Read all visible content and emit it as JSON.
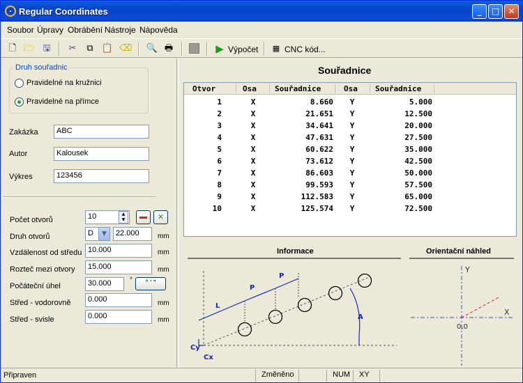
{
  "window": {
    "title": "Regular Coordinates"
  },
  "menu": [
    "Soubor",
    "Úpravy",
    "Obrábění",
    "Nástroje",
    "Nápověda"
  ],
  "toolbar": {
    "compute_label": "Výpočet",
    "cnc_label": "CNC kód...",
    "compute_color": "#13a10e"
  },
  "left": {
    "group_title": "Druh souřadnic",
    "radio_circle": "Pravidelné na kružnici",
    "radio_line": "Pravidelné na přímce",
    "selected": "line",
    "fields": [
      {
        "label": "Zakázka",
        "value": "ABC"
      },
      {
        "label": "Autor",
        "value": "Kalousek"
      },
      {
        "label": "Výkres",
        "value": "123456"
      }
    ],
    "params": {
      "count_label": "Počet otvorů",
      "count_value": "10",
      "type_label": "Druh otvorů",
      "type_value": "D",
      "type_size": "22.000",
      "dist_label": "Vzdálenost od středu",
      "dist_value": "10.000",
      "pitch_label": "Rozteč mezi otvory",
      "pitch_value": "15.000",
      "angle_label": "Počáteční úhel",
      "angle_value": "30.000",
      "angle_unit": "°",
      "dms_label": "° ' \"",
      "cx_label": "Střed - vodorovně",
      "cx_value": "0.000",
      "cy_label": "Střed - svisle",
      "cy_value": "0.000",
      "mm": "mm"
    }
  },
  "coords": {
    "title": "Souřadnice",
    "headers": [
      "Otvor",
      "Osa",
      "Souřadnice",
      "Osa",
      "Souřadnice"
    ],
    "rows": [
      [
        "1",
        "X",
        "8.660",
        "Y",
        "5.000"
      ],
      [
        "2",
        "X",
        "21.651",
        "Y",
        "12.500"
      ],
      [
        "3",
        "X",
        "34.641",
        "Y",
        "20.000"
      ],
      [
        "4",
        "X",
        "47.631",
        "Y",
        "27.500"
      ],
      [
        "5",
        "X",
        "60.622",
        "Y",
        "35.000"
      ],
      [
        "6",
        "X",
        "73.612",
        "Y",
        "42.500"
      ],
      [
        "7",
        "X",
        "86.603",
        "Y",
        "50.000"
      ],
      [
        "8",
        "X",
        "99.593",
        "Y",
        "57.500"
      ],
      [
        "9",
        "X",
        "112.583",
        "Y",
        "65.000"
      ],
      [
        "10",
        "X",
        "125.574",
        "Y",
        "72.500"
      ]
    ]
  },
  "info": {
    "title": "Informace",
    "labels": {
      "L": "L",
      "P1": "P",
      "P2": "P",
      "A": "A",
      "Cy": "Cy",
      "Cx": "Cx"
    }
  },
  "preview": {
    "title": "Orientační náhled",
    "y_label": "Y",
    "x_label": "X",
    "origin_label": "0,0"
  },
  "status": {
    "ready": "Připraven",
    "changed": "Změněno",
    "num": "NUM",
    "xy": "XY"
  }
}
